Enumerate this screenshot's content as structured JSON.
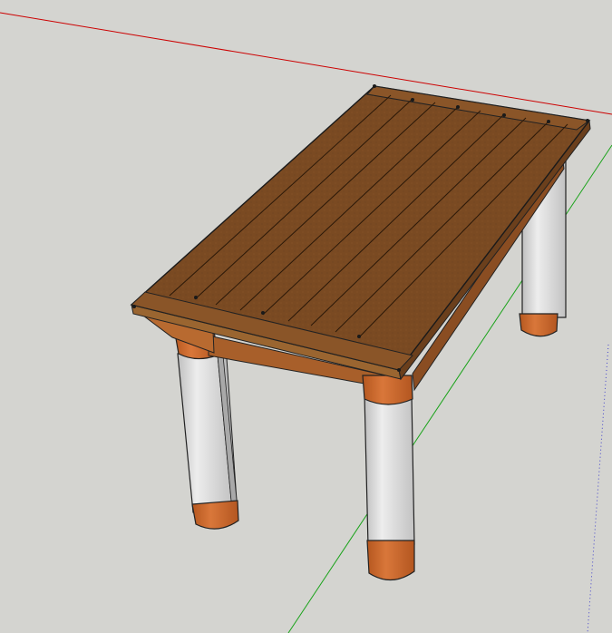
{
  "app": {
    "canvas_background": "#d4d4d0"
  },
  "scene": {
    "object": "table",
    "axes": {
      "red_axis_color": "#cc0000",
      "green_axis_color": "#00aa00",
      "blue_axis_color": "#3333cc"
    },
    "materials": {
      "tabletop_wood": "#7a4a22",
      "tabletop_edge": "#8a5a2a",
      "apron_wood": "#b2682e",
      "leg_shaft": "#d6d6d6",
      "leg_cap": "#c8662a"
    }
  }
}
